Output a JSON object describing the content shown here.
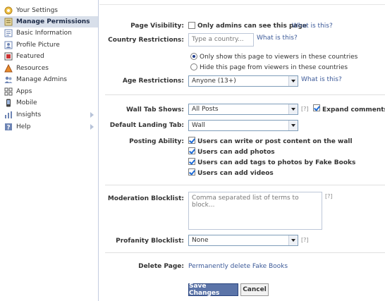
{
  "sidebar": {
    "items": [
      {
        "label": "Your Settings",
        "icon": "settings-icon"
      },
      {
        "label": "Manage Permissions",
        "icon": "permissions-icon"
      },
      {
        "label": "Basic Information",
        "icon": "info-icon"
      },
      {
        "label": "Profile Picture",
        "icon": "picture-icon"
      },
      {
        "label": "Featured",
        "icon": "featured-icon"
      },
      {
        "label": "Resources",
        "icon": "resources-icon"
      },
      {
        "label": "Manage Admins",
        "icon": "admins-icon"
      },
      {
        "label": "Apps",
        "icon": "apps-icon"
      },
      {
        "label": "Mobile",
        "icon": "mobile-icon"
      },
      {
        "label": "Insights",
        "icon": "insights-icon"
      },
      {
        "label": "Help",
        "icon": "help-icon"
      }
    ],
    "active": "Manage Permissions"
  },
  "form": {
    "page_visibility": {
      "label": "Page Visibility:",
      "checkbox_label": "Only admins can see this page",
      "checked": false,
      "help_link": "What is this?"
    },
    "country_restrictions": {
      "label": "Country Restrictions:",
      "placeholder": "Type a country...",
      "help_link": "What is this?",
      "option_show": "Only show this page to viewers in these countries",
      "option_hide": "Hide this page from viewers in these countries",
      "selected": "show"
    },
    "age_restrictions": {
      "label": "Age Restrictions:",
      "value": "Anyone (13+)",
      "help_link": "What is this?"
    },
    "wall_tab_shows": {
      "label": "Wall Tab Shows:",
      "value": "All Posts",
      "help": "[?]",
      "expand_label": "Expand comments o",
      "expand_checked": true
    },
    "default_landing_tab": {
      "label": "Default Landing Tab:",
      "value": "Wall"
    },
    "posting_ability": {
      "label": "Posting Ability:",
      "options": [
        "Users can write or post content on the wall",
        "Users can add photos",
        "Users can add tags to photos by Fake Books",
        "Users can add videos"
      ]
    },
    "moderation_blocklist": {
      "label": "Moderation Blocklist:",
      "placeholder": "Comma separated list of terms to block...",
      "help": "[?]"
    },
    "profanity_blocklist": {
      "label": "Profanity Blocklist:",
      "value": "None",
      "help": "[?]"
    },
    "delete_page": {
      "label": "Delete Page:",
      "link": "Permanently delete Fake Books"
    },
    "buttons": {
      "save": "Save Changes",
      "cancel": "Cancel"
    }
  },
  "colors": {
    "link": "#3b5998",
    "active_bg": "#d8dfea",
    "primary_button": "#5b74a8"
  }
}
